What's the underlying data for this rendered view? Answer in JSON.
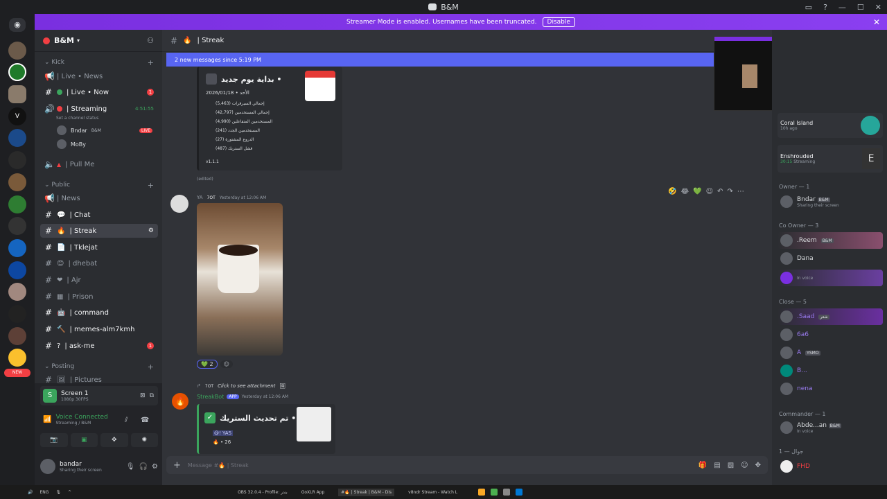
{
  "window": {
    "title": "B&M"
  },
  "banner": {
    "text": "Streamer Mode is enabled. Usernames have been truncated.",
    "action": "Disable"
  },
  "server": {
    "name": "B&M"
  },
  "sidebar": {
    "categories": {
      "kick": "Kick",
      "public": "Public",
      "posting": "Posting"
    },
    "channels": [
      {
        "label": "| Live • News"
      },
      {
        "label": "| Live • Now"
      },
      {
        "label": "| Streaming",
        "timer": "4:51:55",
        "status": "Set a channel status"
      },
      {
        "label": "Bndar",
        "tag": "B&M",
        "live": "LIVE"
      },
      {
        "label": "MoBy"
      },
      {
        "label": "| Pull Me"
      },
      {
        "label": "| News"
      },
      {
        "label": "| Chat"
      },
      {
        "label": "| Streak"
      },
      {
        "label": "| Tklejat"
      },
      {
        "label": "| dhebat"
      },
      {
        "label": "| Ajr"
      },
      {
        "label": "| Prison"
      },
      {
        "label": "| command"
      },
      {
        "label": "| memes-alm7kmh"
      },
      {
        "label": "| ask-me"
      },
      {
        "label": "| Pictures"
      }
    ]
  },
  "voice_panel": {
    "screen_title": "Screen 1",
    "screen_quality": "1080p 30FPS",
    "connected": "Voice Connected",
    "channel": "Streaming / B&M",
    "user_name": "bandar",
    "user_status": "Sharing their screen"
  },
  "chat": {
    "channel_name": "| Streak",
    "new_messages": "2 new messages since 5:19 PM",
    "embed1": {
      "title": "بداية يوم جديد •",
      "date_line": "2026/01/18 • الأحد",
      "lines": [
        "إجمالي السيرفرات (5,463)",
        "إجمالي المستخدمين (42,797)",
        "المستخدمين المتفاعلين (4,990)",
        "المستخدمين الجدد (241)",
        "الدروع المشتورة (27)",
        "فشل الستريك (487)"
      ],
      "version": "v1.1.1",
      "edited": "(edited)"
    },
    "msg2": {
      "name": "YA",
      "tag": "7OT",
      "time": "Yesterday at 12:06 AM",
      "reaction_count": "2"
    },
    "msg3": {
      "reply": "Click to see attachment",
      "reply_tag": "7OT",
      "name": "StreakBot",
      "app": "APP",
      "time": "Yesterday at 12:06 AM",
      "embed_title": "تم تحديث الستريك •",
      "mention": "@! YAS",
      "count": "26"
    },
    "composer_placeholder": "Message #🔥 | Streak"
  },
  "members": {
    "groups": [
      {
        "title": "Owner — 1",
        "members": [
          {
            "name": "Bndar",
            "tag": "B&M",
            "status": "Sharing their screen"
          }
        ]
      },
      {
        "title": "Co Owner — 3",
        "members": [
          {
            "name": ".Reem",
            "tag": "B&M"
          },
          {
            "name": "Dana"
          },
          {
            "name": "",
            "status": "In voice"
          }
        ]
      },
      {
        "title": "Close — 5",
        "members": [
          {
            "name": ".Saad",
            "tag": "شعر"
          },
          {
            "name": "6a6"
          },
          {
            "name": "A",
            "tag": "YSMO"
          },
          {
            "name": "B..."
          },
          {
            "name": "nena"
          }
        ]
      },
      {
        "title": "Commander — 1",
        "members": [
          {
            "name": "Abde...an",
            "tag": "B&M",
            "status": "In voice"
          }
        ]
      },
      {
        "title": "جوال — 1",
        "members": [
          {
            "name": "FHD"
          }
        ]
      }
    ],
    "activities": [
      {
        "name": "Coral Island",
        "time": "10h ago"
      },
      {
        "name": "Enshrouded",
        "time": "30:15",
        "status": "Streaming"
      }
    ]
  },
  "taskbar": {
    "lang": "ENG",
    "apps": [
      "OBS 32.0.4 - Profile: بندر",
      "GoXLR App",
      "#🔥 | Streak | B&M - Dis",
      "v8ndr Stream - Watch L"
    ]
  }
}
